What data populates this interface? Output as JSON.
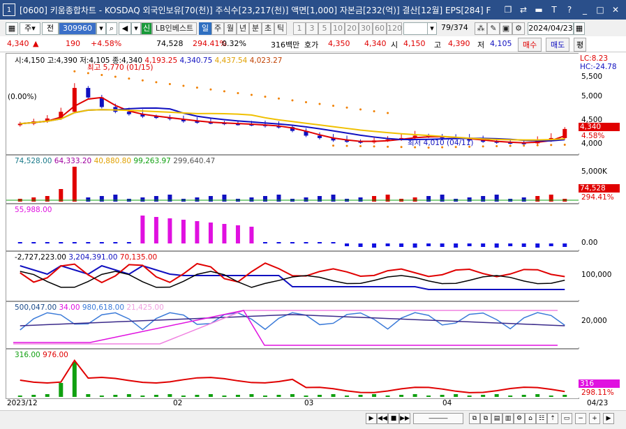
{
  "window": {
    "number": "1",
    "title": "[0600] 키움종합차트 - KOSDAQ 외국인보유[70(천)] 주식수[23,217(천)] 액면[1,000] 자본금[232(억)] 결산[12월] EPS[284] F"
  },
  "toolbar": {
    "period_type": "주",
    "prev_label": "전",
    "code": "309960",
    "broker": "LB인베스트",
    "new_badge": "신",
    "period_buttons": [
      "일",
      "주",
      "월",
      "년",
      "분",
      "초",
      "틱"
    ],
    "active_period": "일",
    "interval_buttons": [
      "1",
      "3",
      "5",
      "10",
      "20",
      "30",
      "60",
      "120"
    ],
    "page": "79",
    "page_total": "/374",
    "date": "2024/04/23"
  },
  "quote": {
    "price": "4,340",
    "change": "190",
    "change_pct": "+4.58%",
    "volume": "74,528",
    "turnover": "294.41%",
    "foreign": "0.32%",
    "amount": "316백만",
    "ask_label": "호가",
    "ask": "4,350",
    "bid": "4,340",
    "open_label": "시",
    "open": "4,150",
    "high_label": "고",
    "high": "4,390",
    "low_label": "저",
    "low": "4,105",
    "buy_label": "매수",
    "sell_label": "매도",
    "extra_label": "평"
  },
  "main_panel": {
    "ohlc": "시:4,150 고:4,390 저:4,105 종:4,340",
    "ma1": "4,193.25",
    "ma2": "4,340.75",
    "ma3": "4,437.54",
    "ma4": "4,023.27",
    "pct": "(0.00%)",
    "high_annot": "최고 5,770 (01/15)",
    "low_annot": "최저 4,010 (04/11)",
    "lc": "LC:8.23",
    "hc": "HC:-24.78",
    "y_ticks": [
      "5,500",
      "5,000",
      "4,500",
      "4,000"
    ],
    "price_tag": "4,340",
    "pct_tag": "4.58%"
  },
  "volume_panel": {
    "legend": [
      "74,528.00",
      "64,333.20",
      "40,880.80",
      "99,263.97",
      "299,640.47"
    ],
    "y_tick": "5,000K",
    "vol_tag": "74,528",
    "turn_tag": "294.41%"
  },
  "panel3": {
    "legend": "55,988.00",
    "y_tick": "0.00"
  },
  "panel4": {
    "legend": [
      "-2,727,223.00",
      "3,204,391.00",
      "70,135.00"
    ],
    "y_tick": "100,000"
  },
  "panel5": {
    "legend": [
      "500,047.00",
      "34.00",
      "980,618.00",
      "21,425.00"
    ],
    "y_tick": "20,000"
  },
  "panel6": {
    "legend": [
      "316.00",
      "976.00"
    ],
    "tag1": "316",
    "tag2": "298.11%"
  },
  "xaxis": {
    "labels": [
      "2023/12",
      "02",
      "03",
      "04"
    ],
    "end": "04/23"
  },
  "colors": {
    "up": "#e00000",
    "down": "#1010c0",
    "magenta": "#e010e0",
    "green": "#10a010",
    "title": "#2a4f8a"
  },
  "chart_data": {
    "type": "line",
    "title": "",
    "candles_close_approx": [
      4450,
      4500,
      4560,
      4700,
      5200,
      5000,
      4800,
      4700,
      4650,
      4600,
      4580,
      4550,
      4500,
      4480,
      4470,
      4450,
      4440,
      4430,
      4400,
      4380,
      4300,
      4200,
      4150,
      4100,
      4080,
      4060,
      4100,
      4120,
      4150,
      4200,
      4180,
      4160,
      4150,
      4100,
      4080,
      4060,
      4050,
      4040,
      4100,
      4150,
      4340
    ],
    "y_range": [
      3900,
      5800
    ]
  }
}
